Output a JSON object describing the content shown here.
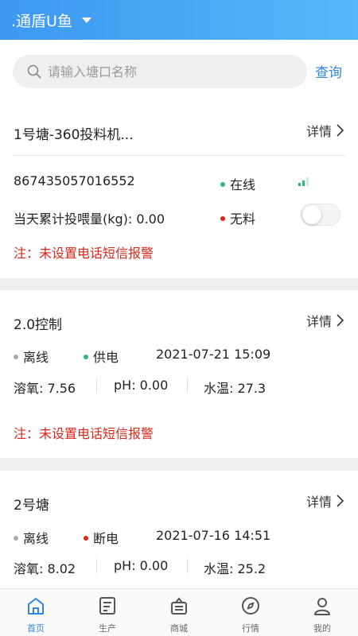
{
  "header": {
    "title": ".通盾U鱼"
  },
  "search": {
    "placeholder": "请输入塘口名称",
    "button": "查询"
  },
  "cards": [
    {
      "title": "1号塘-360投料机...",
      "detail": "详情",
      "device_id": "867435057016552",
      "feed_text": "当天累计投喂量(kg): 0.00",
      "online_status": "在线",
      "feed_status": "无料",
      "note": "注：未设置电话短信报警"
    },
    {
      "title": "2.0控制",
      "detail": "详情",
      "status1": "离线",
      "status2": "供电",
      "datetime": "2021-07-21 15:09",
      "do": "溶氧: 7.56",
      "ph": "pH: 0.00",
      "temp": "水温: 27.3",
      "note": "注：未设置电话短信报警"
    },
    {
      "title": "2号塘",
      "detail": "详情",
      "status1": "离线",
      "status2": "断电",
      "datetime": "2021-07-16 14:51",
      "do": "溶氧: 8.02",
      "ph": "pH: 0.00",
      "temp": "水温: 25.2"
    }
  ],
  "tabs": [
    {
      "label": "首页",
      "icon": "home-icon",
      "active": true
    },
    {
      "label": "生产",
      "icon": "document-icon",
      "active": false
    },
    {
      "label": "商城",
      "icon": "shopping-basket-icon",
      "active": false
    },
    {
      "label": "行情",
      "icon": "compass-icon",
      "active": false
    },
    {
      "label": "我的",
      "icon": "user-icon",
      "active": false
    }
  ],
  "colors": {
    "header_start": "#3c98f2",
    "header_end": "#55b8f8",
    "accent": "#2d86e6",
    "online": "#2fb67c",
    "offline": "#aaaaaa",
    "alert": "#d9271b"
  }
}
